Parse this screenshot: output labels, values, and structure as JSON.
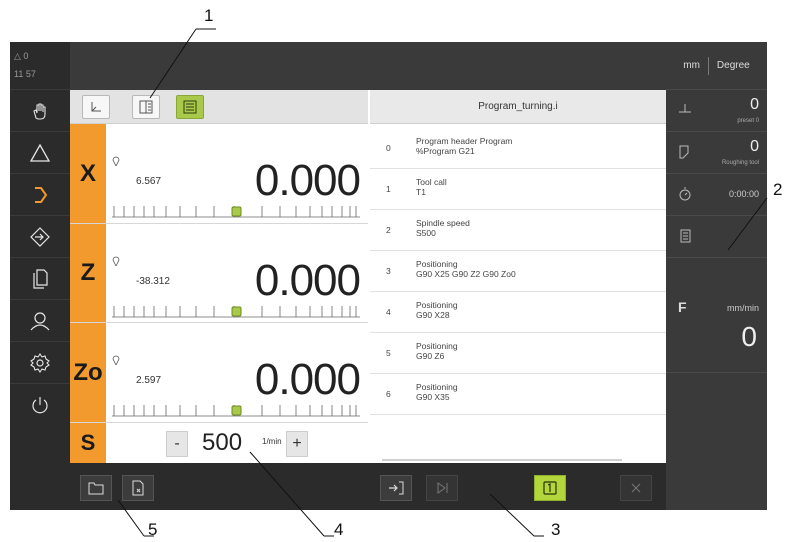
{
  "callouts": [
    "1",
    "2",
    "3",
    "4",
    "5"
  ],
  "status": {
    "top": "△ 0",
    "time": "11 57"
  },
  "sidebar": {
    "items": [
      {
        "icon": "hand-icon"
      },
      {
        "icon": "triangle-icon"
      },
      {
        "icon": "chevron-right-icon"
      },
      {
        "icon": "arrow-diamond-icon"
      },
      {
        "icon": "documents-icon"
      },
      {
        "icon": "user-icon"
      },
      {
        "icon": "gear-icon"
      },
      {
        "icon": "power-icon"
      }
    ]
  },
  "axes": [
    {
      "label": "X",
      "small_value": "6.567",
      "value": "0.000"
    },
    {
      "label": "Z",
      "small_value": "-38.312",
      "value": "0.000"
    },
    {
      "label": "Zo",
      "small_value": "2.597",
      "value": "0.000"
    }
  ],
  "spindle": {
    "label": "S",
    "minus": "-",
    "value": "500",
    "unit": "1/min",
    "plus": "+"
  },
  "program": {
    "title": "Program_turning.i",
    "blocks": [
      {
        "num": "0",
        "line1": "Program header Program",
        "line2": "%Program G21"
      },
      {
        "num": "1",
        "line1": "Tool call",
        "line2": "T1"
      },
      {
        "num": "2",
        "line1": "Spindle speed",
        "line2": "S500"
      },
      {
        "num": "3",
        "line1": "Positioning",
        "line2": "G90 X25 G90 Z2 G90 Zo0"
      },
      {
        "num": "4",
        "line1": "Positioning",
        "line2": "G90 X28"
      },
      {
        "num": "5",
        "line1": "Positioning",
        "line2": "G90 Z6"
      },
      {
        "num": "6",
        "line1": "Positioning",
        "line2": "G90 X35"
      }
    ]
  },
  "right_panel": {
    "units_linear": "mm",
    "units_angular": "Degree",
    "preset_value": "0",
    "preset_label": "preset 0",
    "tool_value": "0",
    "tool_label": "Roughing tool",
    "timer": "0:00:00",
    "feed_label": "F",
    "feed_unit": "mm/min",
    "feed_value": "0"
  }
}
